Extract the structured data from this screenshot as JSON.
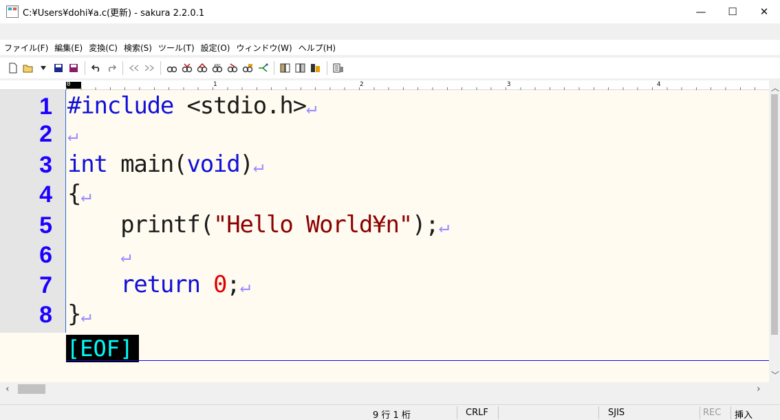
{
  "window": {
    "title": "C:¥Users¥dohi¥a.c(更新) - sakura 2.2.0.1",
    "minimize": "—",
    "maximize": "☐",
    "close": "✕"
  },
  "menu": [
    "ファイル(F)",
    "編集(E)",
    "変換(C)",
    "検索(S)",
    "ツール(T)",
    "設定(O)",
    "ウィンドウ(W)",
    "ヘルプ(H)"
  ],
  "toolbar": {
    "icons": [
      "new-icon",
      "open-icon",
      "dropdown-icon",
      "save-icon",
      "save-as-icon",
      "undo-icon",
      "redo-icon",
      "jump-back-icon",
      "jump-forward-icon",
      "search-icon",
      "search-next-icon",
      "search-prev-icon",
      "replace-icon",
      "grep-icon",
      "filter-icon",
      "bookmark-icon",
      "outline-icon",
      "compare-icon",
      "tag-icon",
      "settings-icon"
    ]
  },
  "ruler": {
    "marks": [
      "0",
      "1",
      "2",
      "3",
      "4"
    ]
  },
  "editor": {
    "lines": [
      {
        "num": "1",
        "text": "#include <stdio.h>"
      },
      {
        "num": "2",
        "text": ""
      },
      {
        "num": "3",
        "text": "int main(void)"
      },
      {
        "num": "4",
        "text": "{"
      },
      {
        "num": "5",
        "text": "    printf(\"Hello World¥n\");"
      },
      {
        "num": "6",
        "text": ""
      },
      {
        "num": "7",
        "text": "    return 0;"
      },
      {
        "num": "8",
        "text": "}"
      }
    ],
    "eof": "[EOF]",
    "return_glyph": "↵"
  },
  "status": {
    "position": "9 行   1 桁",
    "line_ending": "CRLF",
    "encoding": "SJIS",
    "rec": "REC",
    "mode": "挿入"
  },
  "colors": {
    "line_number": "#1d00ff",
    "keyword": "#1010d8",
    "string": "#8b0000",
    "number": "#e00000",
    "eof_bg": "#000000",
    "eof_fg": "#00ffff",
    "editor_bg": "#fffbf0"
  }
}
